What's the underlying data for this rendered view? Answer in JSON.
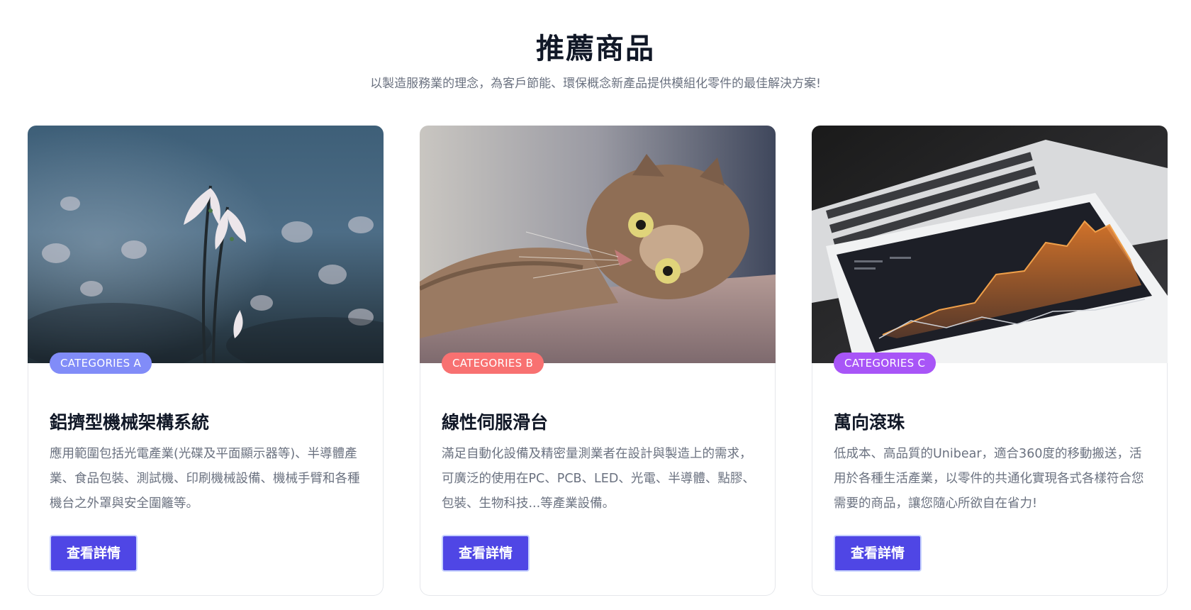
{
  "section": {
    "title": "推薦商品",
    "subtitle": "以製造服務業的理念，為客戶節能、環保概念新產品提供模組化零件的最佳解決方案!"
  },
  "cards": [
    {
      "badge": "CATEGORIES A",
      "badge_color": "#818cf8",
      "image_icon": "snowdrop-flowers-photo",
      "title": "鋁擠型機械架構系統",
      "description": "應用範圍包括光電產業(光碟及平面顯示器等)、半導體產業、食品包裝、測試機、印刷機械設備、機械手臂和各種機台之外罩與安全圍籬等。",
      "button_label": "查看詳情"
    },
    {
      "badge": "CATEGORIES B",
      "badge_color": "#f87171",
      "image_icon": "cat-photo",
      "title": "線性伺服滑台",
      "description": "滿足自動化設備及精密量測業者在設計與製造上的需求，可廣泛的使用在PC、PCB、LED、光電、半導體、點膠、包裝、生物科技...等產業設備。",
      "button_label": "查看詳情"
    },
    {
      "badge": "CATEGORIES C",
      "badge_color": "#a855f7",
      "image_icon": "laptop-tablet-chart-photo",
      "title": "萬向滾珠",
      "description": "低成本、高品質的Unibear，適合360度的移動搬送，活用於各種生活產業，以零件的共通化實現各式各樣符合您需要的商品，讓您隨心所欲自在省力!",
      "button_label": "查看詳情"
    }
  ],
  "colors": {
    "button": "#4f46e5",
    "title": "#111827",
    "text": "#6b7280"
  }
}
